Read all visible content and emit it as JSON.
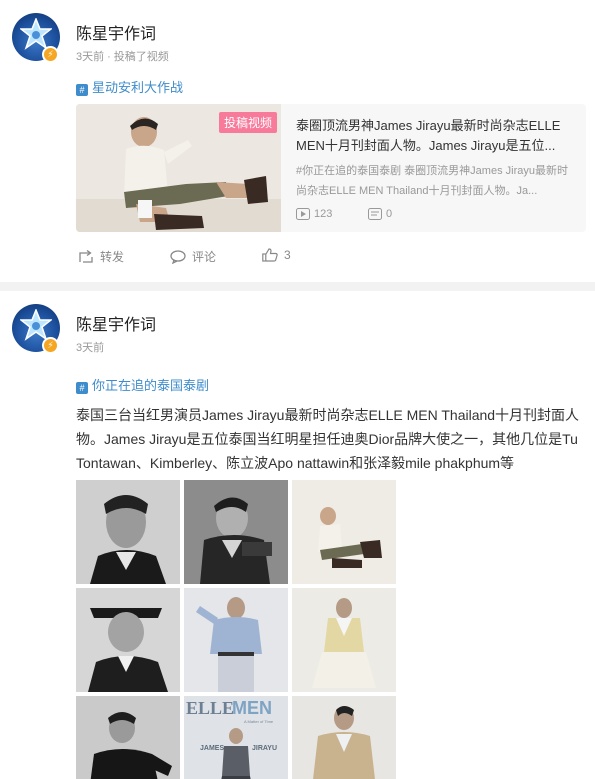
{
  "posts": [
    {
      "username": "陈星宇作词",
      "time": "3天前",
      "action": "投稿了视频",
      "topic": "星动安利大作战",
      "card": {
        "tag": "投稿视频",
        "title": "泰圈顶流男神James Jirayu最新时尚杂志ELLE MEN十月刊封面人物。James Jirayu是五位...",
        "desc": "#你正在追的泰国泰剧 泰圈顶流男神James Jirayu最新时尚杂志ELLE MEN Thailand十月刊封面人物。Ja...",
        "plays": "123",
        "comments": "0"
      },
      "actions": {
        "repost": "转发",
        "comment": "评论",
        "like": "3"
      }
    },
    {
      "username": "陈星宇作词",
      "time": "3天前",
      "topic": "你正在追的泰国泰剧",
      "text": "泰国三台当红男演员James Jirayu最新时尚杂志ELLE MEN Thailand十月刊封面人物。James Jirayu是五位泰国当红明星担任迪奥Dior品牌大使之一，其他几位是Tu Tontawan、Kimberley、陈立波Apo nattawin和张泽毅mile phakphum等",
      "magazine": {
        "logo_left": "ELLE",
        "logo_right": "MEN",
        "subline": "A Matter of Time",
        "cover_name_left": "JAMES",
        "cover_name_right": "JIRAYU"
      }
    }
  ],
  "icons": {
    "topic": "hash-icon",
    "play": "play-icon",
    "comment_count": "comment-icon",
    "repost": "repost-icon",
    "comment": "comment-icon",
    "like": "like-icon",
    "verified": "lightning-icon"
  },
  "colors": {
    "link": "#3e8ccb",
    "tag": "#f77a9b",
    "verified": "#f5a623",
    "muted": "#999999"
  }
}
